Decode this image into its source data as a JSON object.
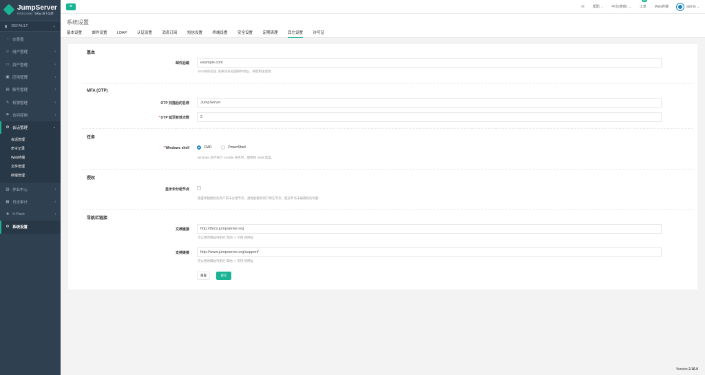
{
  "sidebar": {
    "logo_title": "JumpServer",
    "logo_sub": "FIT2CLOUD 飞致云 旗下品牌",
    "org": "DEFAULT",
    "items": [
      {
        "label": "仪表盘",
        "icon": "dashboard-icon"
      },
      {
        "label": "用户管理",
        "icon": "users-icon"
      },
      {
        "label": "资产管理",
        "icon": "inbox-icon"
      },
      {
        "label": "应用管理",
        "icon": "apps-icon"
      },
      {
        "label": "账号管理",
        "icon": "account-icon"
      },
      {
        "label": "权限管理",
        "icon": "permission-icon"
      },
      {
        "label": "访问控制",
        "icon": "access-icon"
      },
      {
        "label": "会话管理",
        "icon": "session-icon"
      }
    ],
    "session_sub": [
      "会话管理",
      "命令记录",
      "Web终端",
      "文件管理",
      "终端管理"
    ],
    "items_after": [
      {
        "label": "作业中心",
        "icon": "jobs-icon"
      },
      {
        "label": "日志审计",
        "icon": "audit-icon"
      },
      {
        "label": "X-Pack",
        "icon": "xpack-icon"
      },
      {
        "label": "系统设置",
        "icon": "settings-icon"
      }
    ]
  },
  "topbar": {
    "mail_icon": "mail-icon",
    "help": "帮助",
    "lang": "中文(简体)",
    "tickets": "工单",
    "tickets_badge": "12",
    "webterminal": "Web终端",
    "user": "admin"
  },
  "page": {
    "title": "系统设置",
    "tabs": [
      "基本设置",
      "邮件设置",
      "LDAP",
      "认证设置",
      "消息订阅",
      "短信设置",
      "终端设置",
      "安全设置",
      "定期清理",
      "其它设置",
      "许可证"
    ],
    "active_tab": "其它设置"
  },
  "form": {
    "basic": {
      "title": "基本",
      "email_suffix_label": "邮件后缀",
      "email_suffix_value": "example.com",
      "email_suffix_help": "SSO身份验证, 如果没有返回邮件地址，将使用该后缀"
    },
    "mfa": {
      "title": "MFA (OTP)",
      "issuer_label": "OTP 扫描后的名称",
      "issuer_value": "JumpServer",
      "window_label": "OTP 延迟有效次数",
      "window_value": "2"
    },
    "tasks": {
      "title": "任务",
      "shell_label": "Windows shell",
      "options": [
        "CMD",
        "PowerShell"
      ],
      "selected": "CMD",
      "help": "windows 资产执行 Ansible 任务时，使用的 Shell 类型。"
    },
    "perm": {
      "title": "授权",
      "unassigned_label": "显示未分组节点",
      "help": "放置单独授权的资产到未分组节点，避免能看到资产所在节点，但该节点未被授权的问题"
    },
    "nav": {
      "title": "导航栏链接",
      "doc_label": "文档链接",
      "doc_value": "http://docs.jumpserver.org",
      "doc_help": "可以更改网站导航栏 帮助 -> 文档 的网址",
      "support_label": "支持链接",
      "support_value": "http://www.jumpserver.org/support/",
      "support_help": "可以更改网站导航栏 帮助 -> 支持 的网址"
    },
    "reset": "重置",
    "submit": "提交"
  },
  "footer": {
    "prefix": "Version",
    "version": "2.16.0"
  }
}
